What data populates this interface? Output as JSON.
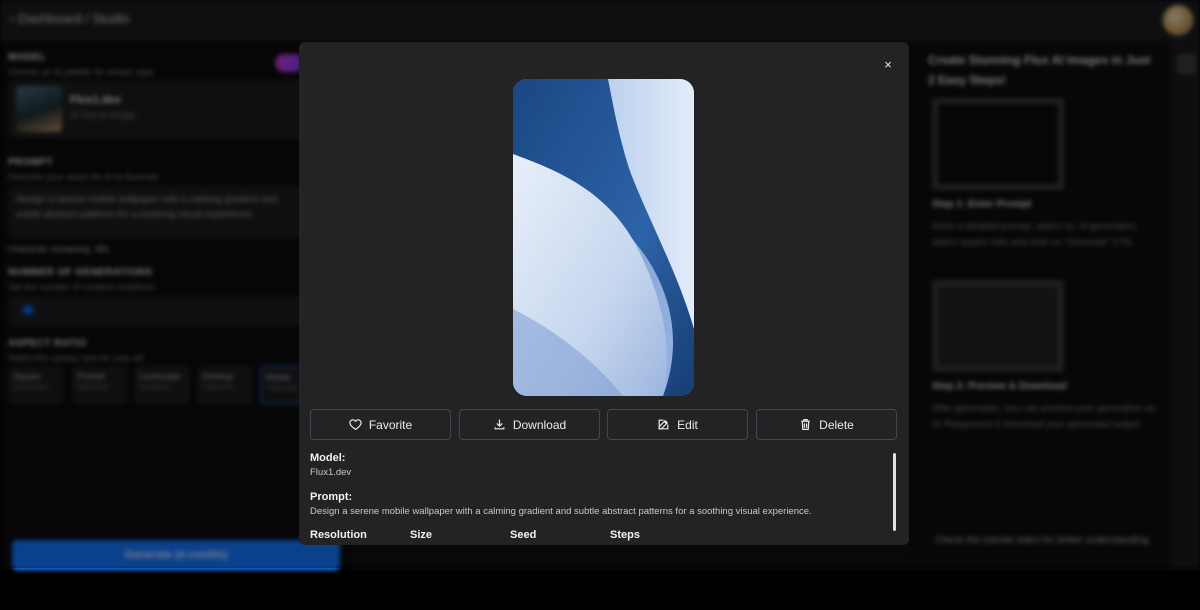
{
  "background": {
    "breadcrumb": "Dashboard / Studio",
    "model_section": {
      "title": "MODEL",
      "subtitle": "Choose an AI palette for artistic style",
      "model_name": "Flux1.dev",
      "model_sub": "AI Text to Image"
    },
    "prompt_section": {
      "title": "PROMPT",
      "subtitle": "Describe your vision for AI to illustrate",
      "text": "Design a serene mobile wallpaper with a calming gradient and subtle abstract patterns for a soothing visual experience.",
      "chars_remaining": "Character remaining: 381"
    },
    "generations_section": {
      "title": "NUMBER OF GENERATIONS",
      "subtitle": "Set the number of creative variations"
    },
    "aspect_section": {
      "title": "ASPECT RATIO",
      "subtitle": "Select the canvas size for your art",
      "options": [
        {
          "label": "Square",
          "sub": "1024x1024"
        },
        {
          "label": "Portrait",
          "sub": "832x1216"
        },
        {
          "label": "Landscape",
          "sub": "1216x832"
        },
        {
          "label": "Desktop",
          "sub": "1344x768"
        },
        {
          "label": "Mobile",
          "sub": "768x1344"
        }
      ]
    },
    "generate_button": "Generate (4 credits)",
    "right_panel": {
      "title": "Create Stunning Flux AI Images in Just 2 Easy Steps!",
      "step1_title": "Step 1: Enter Prompt",
      "step1_text": "Enter a detailed prompt, select no. of generation, select aspect ratio and click on \"Generate\" CTA.",
      "step2_title": "Step 2: Preview & Download",
      "step2_text": "After generation, you can preview your generation on AI Playground & download your generated output.",
      "tutorial_text": "Check the tutorial video for better understanding"
    }
  },
  "modal": {
    "close_label": "×",
    "actions": [
      {
        "id": "favorite",
        "label": "Favorite",
        "icon": "heart-icon"
      },
      {
        "id": "download",
        "label": "Download",
        "icon": "download-icon"
      },
      {
        "id": "edit",
        "label": "Edit",
        "icon": "edit-icon"
      },
      {
        "id": "delete",
        "label": "Delete",
        "icon": "trash-icon"
      }
    ],
    "details": {
      "model_label": "Model:",
      "model_value": "Flux1.dev",
      "prompt_label": "Prompt:",
      "prompt_value": "Design a serene mobile wallpaper with a calming gradient and subtle abstract patterns for a soothing visual experience.",
      "cut_labels": [
        "Resolution",
        "Size",
        "Seed",
        "Steps"
      ]
    }
  },
  "colors": {
    "accent": "#1476ff",
    "modal_bg": "#232325",
    "wallpaper_dark": "#1c4a8a",
    "wallpaper_light": "#dfe9fa"
  }
}
